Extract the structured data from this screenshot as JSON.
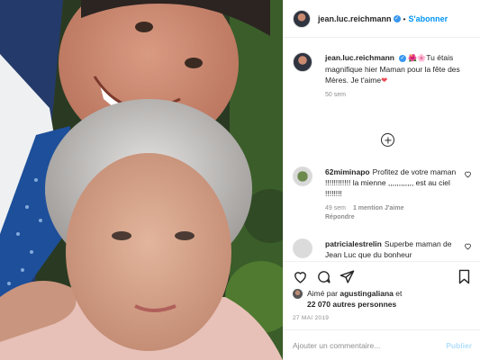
{
  "post": {
    "username": "jean.luc.reichmann",
    "dot": "•",
    "follow_label": "S'abonner",
    "caption": "Tu étais magnifique hier Maman pour la fête des Mères. Je t'aime",
    "caption_time": "50 sem",
    "date": "27 MAI 2019"
  },
  "comments": [
    {
      "username": "62miminapo",
      "text": "Profitez de votre maman !!!!!!!!!!!! la mienne ,,,,,,,,,,,, est au ciel !!!!!!!!",
      "time": "49 sem",
      "likes": "1 mention J'aime",
      "reply": "Répondre"
    },
    {
      "username": "patricialestrelin",
      "text": "Superbe maman de Jean Luc que du bonheur"
    }
  ],
  "likes": {
    "prefix": "Aimé par",
    "user": "agustingaliana",
    "middle": "et",
    "count": "22 070 autres personnes"
  },
  "add_comment": {
    "placeholder": "Ajouter un commentaire...",
    "publish_label": "Publier"
  },
  "colors": {
    "accent": "#0095f6",
    "heart": "#ed4956"
  }
}
